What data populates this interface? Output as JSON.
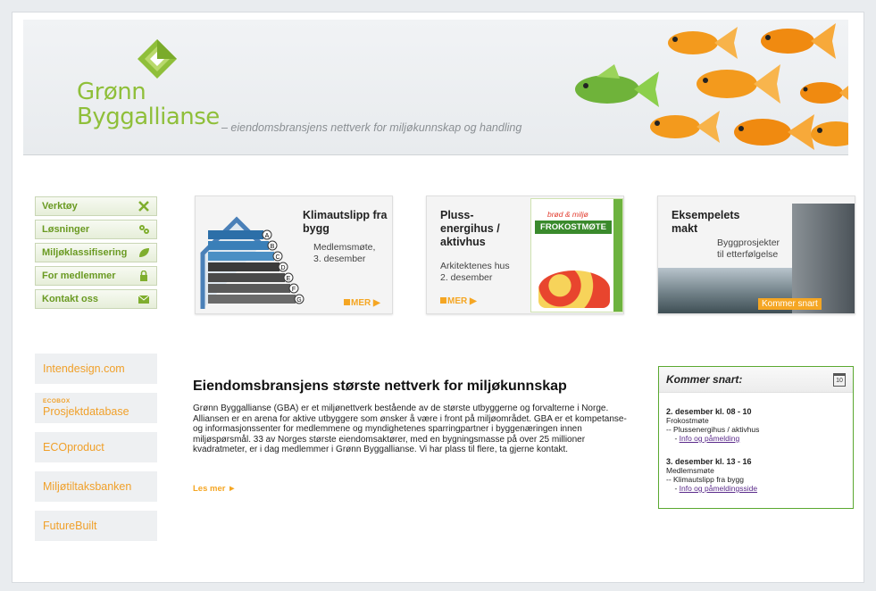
{
  "header": {
    "logo_line1": "Grønn",
    "logo_line2": "Byggallianse",
    "tagline": "– eiendomsbransjens nettverk for miljøkunnskap og handling"
  },
  "nav": {
    "items": [
      {
        "label": "Verktøy",
        "icon": "tools-icon"
      },
      {
        "label": "Løsninger",
        "icon": "gears-icon"
      },
      {
        "label": "Miljøklassifisering",
        "icon": "leaf-icon"
      },
      {
        "label": "For medlemmer",
        "icon": "lock-icon"
      },
      {
        "label": "Kontakt oss",
        "icon": "envelope-icon"
      }
    ]
  },
  "teasers": [
    {
      "title": "Klimautslipp fra bygg",
      "text1": "Medlemsmøte,",
      "text2": "3. desember",
      "link": "MER"
    },
    {
      "title": "Pluss-energihus / aktivhus",
      "text1": "Arkitektenes hus",
      "text2": "2. desember",
      "link": "MER",
      "box_brand": "brød & miljø",
      "box_title": "FROKOSTMØTE"
    },
    {
      "title": "Eksempelets makt",
      "text1": "Byggprosjekter",
      "text2": "til etterfølgelse",
      "link": "Kommer snart"
    }
  ],
  "energy_labels": [
    "A",
    "B",
    "C",
    "D",
    "E",
    "F",
    "G"
  ],
  "partners": [
    {
      "label": "Intendesign.com"
    },
    {
      "small": "ECOBOX",
      "label": "Prosjektdatabase"
    },
    {
      "label": "ECOproduct"
    },
    {
      "label": "Miljøtiltaksbanken"
    },
    {
      "label": "FutureBuilt"
    }
  ],
  "main": {
    "title": "Eiendomsbransjens største nettverk for miljøkunnskap",
    "body": "Grønn Byggallianse (GBA) er et miljønettverk bestående av de største utbyggerne og forvalterne i Norge. Alliansen er en arena for aktive utbyggere som ønsker å være i front på miljøområdet. GBA er et kompetanse- og informasjonssenter for medlemmene og myndighetenes sparringpartner i byggenæringen innen miljøspørsmål. 33 av Norges største eiendomsaktører, med en bygningsmasse på over 25 millioner kvadratmeter, er i dag medlemmer i Grønn Byggallianse. Vi har plass til flere, ta gjerne kontakt.",
    "read_more": "Les mer ►"
  },
  "events": {
    "title": "Kommer snart:",
    "calendar_day": "10",
    "items": [
      {
        "date": "2. desember kl. 08 - 10",
        "type": "Frokostmøte",
        "topic": "-- Plussenergihus / aktivhus",
        "link": "Info og påmelding"
      },
      {
        "date": "3. desember kl. 13 - 16",
        "type": "Medlemsmøte",
        "topic": "-- Klimautslipp fra bygg",
        "link": "Info og påmeldingsside"
      }
    ]
  },
  "colors": {
    "brand_green": "#8fbf3a",
    "nav_green": "#6a9a22",
    "accent_orange": "#f5a623",
    "events_border": "#5aa830"
  }
}
